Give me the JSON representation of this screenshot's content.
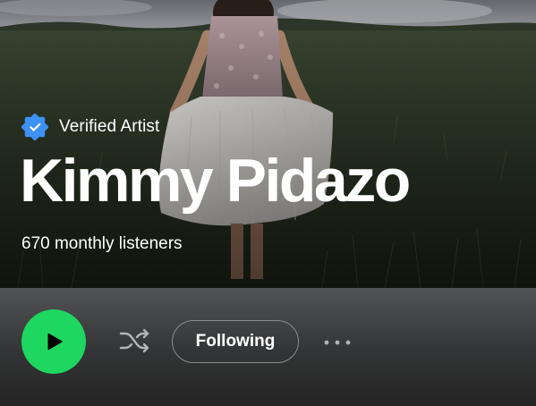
{
  "hero": {
    "verified_label": "Verified Artist",
    "artist_name": "Kimmy Pidazo",
    "listeners": "670 monthly listeners",
    "photo_icon": "artist-banner-photo"
  },
  "actions": {
    "play_icon": "play-icon",
    "shuffle_icon": "shuffle-icon",
    "follow_label": "Following",
    "more_icon": "more-options-icon"
  },
  "colors": {
    "play_button": "#1ed760",
    "verified_badge": "#3d91f4",
    "text": "#ffffff",
    "action_bar_top": "#515354",
    "action_bar_bottom": "#242424"
  }
}
